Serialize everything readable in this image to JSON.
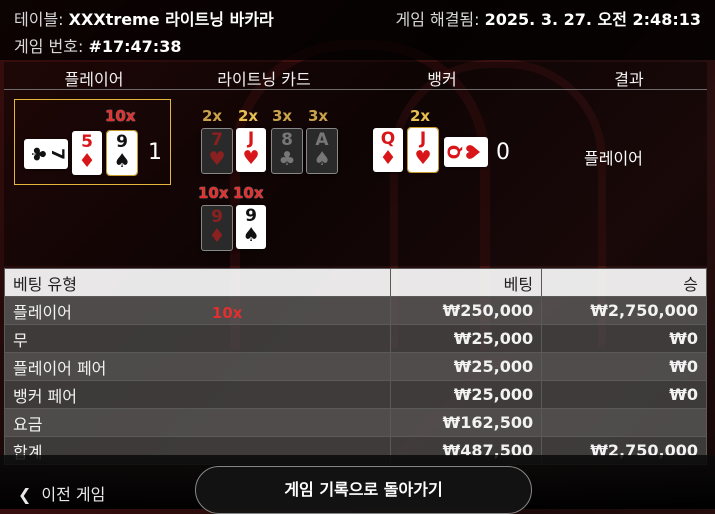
{
  "header": {
    "table_label": "테이블:",
    "table_name": "XXXtreme 라이트닝 바카라",
    "round_label": "게임 번호:",
    "round_id": "#17:47:38",
    "resolved_label": "게임 해결됨:",
    "resolved_time": "2025. 3. 27. 오전 2:48:13"
  },
  "columns": {
    "player": "플레이어",
    "lightning": "라이트닝 카드",
    "banker": "뱅커",
    "result": "결과"
  },
  "player": {
    "cards": [
      {
        "rank": "7",
        "suit": "♣",
        "color": "#111111",
        "orientation": "rotated"
      },
      {
        "rank": "5",
        "suit": "♦",
        "color": "#d8161a"
      },
      {
        "rank": "9",
        "suit": "♠",
        "color": "#111111"
      }
    ],
    "multiplier": "10x",
    "score": "1"
  },
  "lightning": {
    "row1": [
      {
        "mult": "2x",
        "rank": "7",
        "suit": "♥",
        "color": "#8a2020",
        "active": false
      },
      {
        "mult": "2x",
        "rank": "J",
        "suit": "♥",
        "color": "#d8161a",
        "active": true
      },
      {
        "mult": "3x",
        "rank": "8",
        "suit": "♣",
        "color": "#777777",
        "active": false
      },
      {
        "mult": "3x",
        "rank": "A",
        "suit": "♠",
        "color": "#777777",
        "active": false
      }
    ],
    "row2": [
      {
        "mult": "10x",
        "rank": "9",
        "suit": "♦",
        "color": "#8a2020",
        "active": false
      },
      {
        "mult": "10x",
        "rank": "9",
        "suit": "♠",
        "color": "#111111",
        "active": true
      }
    ]
  },
  "banker": {
    "cards": [
      {
        "rank": "Q",
        "suit": "♦",
        "color": "#d8161a"
      },
      {
        "rank": "J",
        "suit": "♥",
        "color": "#d8161a"
      },
      {
        "rank": "Q",
        "suit": "♥",
        "color": "#d8161a",
        "orientation": "rotated"
      }
    ],
    "multiplier": "2x",
    "score": "0"
  },
  "result": "플레이어",
  "bets_table": {
    "headers": [
      "베팅 유형",
      "베팅",
      "승"
    ],
    "rows": [
      {
        "type": "플레이어",
        "mult": "10x",
        "bet": "₩250,000",
        "win": "₩2,750,000"
      },
      {
        "type": "무",
        "mult": "",
        "bet": "₩25,000",
        "win": "₩0"
      },
      {
        "type": "플레이어 페어",
        "mult": "",
        "bet": "₩25,000",
        "win": "₩0"
      },
      {
        "type": "뱅커 페어",
        "mult": "",
        "bet": "₩25,000",
        "win": "₩0"
      },
      {
        "type": "요금",
        "mult": "",
        "bet": "₩162,500",
        "win": ""
      },
      {
        "type": "합계",
        "mult": "",
        "bet": "₩487,500",
        "win": "₩2,750,000"
      }
    ]
  },
  "footer": {
    "prev_game": "이전 게임",
    "back_to_history": "게임 기록으로 돌아가기"
  },
  "icons": {
    "prev": "chevron-left-icon"
  }
}
